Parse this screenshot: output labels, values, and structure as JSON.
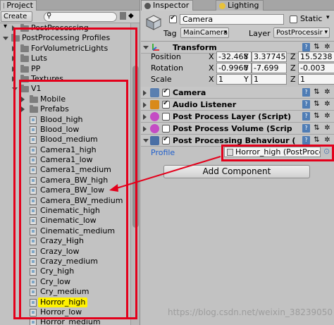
{
  "project": {
    "tab_label": "Project",
    "create_label": "Create",
    "tree": [
      {
        "label": "PostProcessing",
        "depth": 1,
        "type": "folder",
        "open": false
      },
      {
        "label": "PostProcessing Profiles",
        "depth": 0,
        "type": "folder",
        "open": true
      },
      {
        "label": "ForVolumetricLights",
        "depth": 1,
        "type": "folder",
        "open": false
      },
      {
        "label": "Luts",
        "depth": 1,
        "type": "folder",
        "open": false
      },
      {
        "label": "PP",
        "depth": 1,
        "type": "folder",
        "open": false
      },
      {
        "label": "Textures",
        "depth": 1,
        "type": "folder",
        "open": false
      },
      {
        "label": "V1",
        "depth": 1,
        "type": "folder",
        "open": true
      },
      {
        "label": "Mobile",
        "depth": 2,
        "type": "folder",
        "open": false
      },
      {
        "label": "Prefabs",
        "depth": 2,
        "type": "folder",
        "open": false
      },
      {
        "label": "Blood_high",
        "depth": 2,
        "type": "asset"
      },
      {
        "label": "Blood_low",
        "depth": 2,
        "type": "asset"
      },
      {
        "label": "Blood_medium",
        "depth": 2,
        "type": "asset"
      },
      {
        "label": "Camera1_high",
        "depth": 2,
        "type": "asset"
      },
      {
        "label": "Camera1_low",
        "depth": 2,
        "type": "asset"
      },
      {
        "label": "Camera1_medium",
        "depth": 2,
        "type": "asset"
      },
      {
        "label": "Camera_BW_high",
        "depth": 2,
        "type": "asset"
      },
      {
        "label": "Camera_BW_low",
        "depth": 2,
        "type": "asset"
      },
      {
        "label": "Camera_BW_medium",
        "depth": 2,
        "type": "asset"
      },
      {
        "label": "Cinematic_high",
        "depth": 2,
        "type": "asset"
      },
      {
        "label": "Cinematic_low",
        "depth": 2,
        "type": "asset"
      },
      {
        "label": "Cinematic_medium",
        "depth": 2,
        "type": "asset"
      },
      {
        "label": "Crazy_High",
        "depth": 2,
        "type": "asset"
      },
      {
        "label": "Crazy_low",
        "depth": 2,
        "type": "asset"
      },
      {
        "label": "Crazy_medium",
        "depth": 2,
        "type": "asset"
      },
      {
        "label": "Cry_high",
        "depth": 2,
        "type": "asset"
      },
      {
        "label": "Cry_low",
        "depth": 2,
        "type": "asset"
      },
      {
        "label": "Cry_medium",
        "depth": 2,
        "type": "asset"
      },
      {
        "label": "Horror_high",
        "depth": 2,
        "type": "asset",
        "selected": true
      },
      {
        "label": "Horror_low",
        "depth": 2,
        "type": "asset"
      },
      {
        "label": "Horror_medium",
        "depth": 2,
        "type": "asset"
      }
    ]
  },
  "inspector": {
    "tab_label": "Inspector",
    "lighting_tab_label": "Lighting",
    "object_name": "Camera",
    "static_label": "Static",
    "tag_label": "Tag",
    "tag_value": "MainCamera",
    "layer_label": "Layer",
    "layer_value": "PostProcessir",
    "transform": {
      "title": "Transform",
      "rows": [
        {
          "label": "Position",
          "x": "-32.468",
          "y": "3.37745",
          "z": "15.5238"
        },
        {
          "label": "Rotation",
          "x": "-0.9960",
          "y": "-7.699",
          "z": "-0.003"
        },
        {
          "label": "Scale",
          "x": "1",
          "y": "1",
          "z": "1"
        }
      ]
    },
    "components": [
      {
        "title": "Camera",
        "icon_color": "#5a7fb0",
        "checked": true
      },
      {
        "title": "Audio Listener",
        "icon_color": "#d98a1a",
        "checked": true
      },
      {
        "title": "Post Process Layer (Script)",
        "icon_color": "#c44cc4",
        "checked": false
      },
      {
        "title": "Post Process Volume (Scrip",
        "icon_color": "#c44cc4",
        "checked": false
      },
      {
        "title": "Post Processing Behaviour (",
        "icon_color": "#4a6fa5",
        "checked": true
      }
    ],
    "profile_label": "Profile",
    "profile_value": "Horror_high (PostProce",
    "add_component_label": "Add Component"
  },
  "watermark": "https://blog.csdn.net/weixin_38239050",
  "colors": {
    "annotation_red": "#e3001b",
    "selection_yellow": "#fff200",
    "profile_label_blue": "#1f5fcc"
  }
}
